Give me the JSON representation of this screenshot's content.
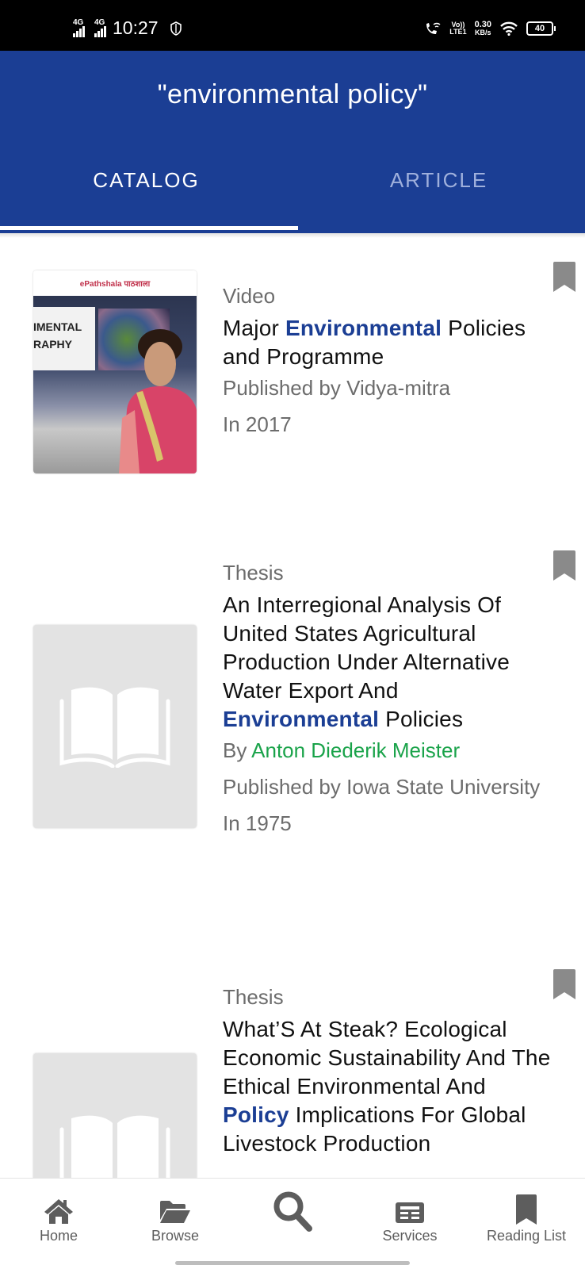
{
  "status_bar": {
    "network1": "4G",
    "network2": "4G",
    "time": "10:27",
    "volte_top": "Vo))",
    "volte_bottom": "LTE1",
    "speed_value": "0.30",
    "speed_unit": "KB/s",
    "battery": "40"
  },
  "header": {
    "title": "\"environmental policy\""
  },
  "tabs": [
    {
      "label": "CATALOG",
      "active": true
    },
    {
      "label": "ARTICLE",
      "active": false
    }
  ],
  "results": [
    {
      "type": "Video",
      "title_parts": [
        {
          "text": "Major ",
          "highlight": false
        },
        {
          "text": "Environmental",
          "highlight": true
        },
        {
          "text": " Policies and Programme",
          "highlight": false
        }
      ],
      "author_prefix": "",
      "author": "",
      "publisher": "Published by Vidya-mitra",
      "year": "In 2017",
      "thumbnail": "video-frame",
      "thumb_logo": "ePathshala पाठशाला",
      "thumb_card_text": "IMENTAL RAPHY"
    },
    {
      "type": "Thesis",
      "title_parts": [
        {
          "text": "An Interregional Analysis Of United States Agricultural Production Under Alternative Water Export And ",
          "highlight": false
        },
        {
          "text": "Environmental",
          "highlight": true
        },
        {
          "text": " Policies",
          "highlight": false
        }
      ],
      "author_prefix": "By ",
      "author": "Anton Diederik Meister",
      "publisher": "Published by Iowa State University",
      "year": "In 1975",
      "thumbnail": "book-placeholder"
    },
    {
      "type": "Thesis",
      "title_parts": [
        {
          "text": "What’S At Steak? Ecological Economic Sustainability And The Ethical Environmental And ",
          "highlight": false
        },
        {
          "text": "Policy",
          "highlight": true
        },
        {
          "text": " Implications For Global Livestock Production",
          "highlight": false
        }
      ],
      "author_prefix": "",
      "author": "",
      "publisher": "",
      "year": "",
      "thumbnail": "book-placeholder"
    }
  ],
  "bottom_nav": [
    {
      "label": "Home",
      "icon": "home-icon"
    },
    {
      "label": "Browse",
      "icon": "folder-open-icon"
    },
    {
      "label": "",
      "icon": "search-icon"
    },
    {
      "label": "Services",
      "icon": "newspaper-icon"
    },
    {
      "label": "Reading List",
      "icon": "bookmark-icon"
    }
  ],
  "colors": {
    "primary": "#1b3e94",
    "highlight": "#1b3e94",
    "author": "#1aa34a",
    "muted": "#6c6c6c",
    "icon": "#5d5d5d",
    "bookmark": "#8a8a8a"
  }
}
